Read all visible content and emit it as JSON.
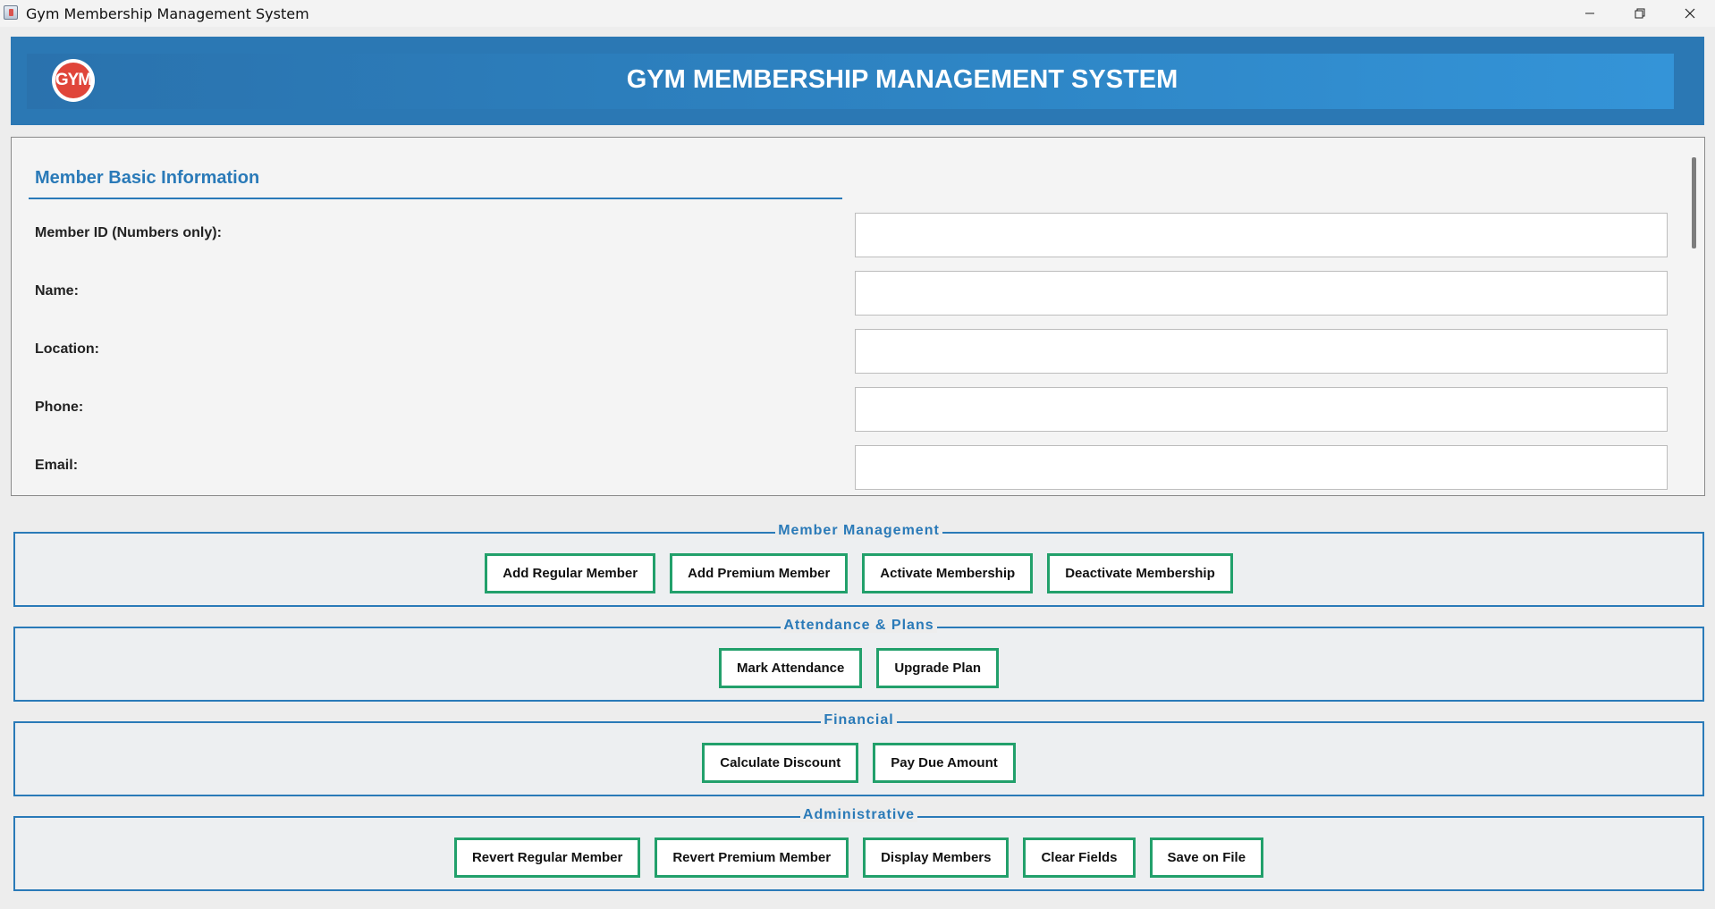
{
  "window": {
    "title": "Gym Membership Management System",
    "controls": {
      "minimize": "—",
      "maximize": "❐",
      "close": "✕"
    }
  },
  "header": {
    "logo_text": "GYM",
    "title": "GYM MEMBERSHIP MANAGEMENT SYSTEM"
  },
  "member_info": {
    "section_title": "Member Basic Information",
    "fields": [
      {
        "label": "Member ID (Numbers only):",
        "value": ""
      },
      {
        "label": "Name:",
        "value": ""
      },
      {
        "label": "Location:",
        "value": ""
      },
      {
        "label": "Phone:",
        "value": ""
      },
      {
        "label": "Email:",
        "value": ""
      }
    ]
  },
  "groups": [
    {
      "title": "Member Management",
      "buttons": [
        "Add Regular Member",
        "Add Premium Member",
        "Activate Membership",
        "Deactivate Membership"
      ]
    },
    {
      "title": "Attendance & Plans",
      "buttons": [
        "Mark Attendance",
        "Upgrade Plan"
      ]
    },
    {
      "title": "Financial",
      "buttons": [
        "Calculate Discount",
        "Pay Due Amount"
      ]
    },
    {
      "title": "Administrative",
      "buttons": [
        "Revert Regular Member",
        "Revert Premium Member",
        "Display Members",
        "Clear Fields",
        "Save on File"
      ]
    }
  ],
  "colors": {
    "accent": "#2a7ab8",
    "button_border": "#22a06b",
    "logo": "#e0453a"
  }
}
